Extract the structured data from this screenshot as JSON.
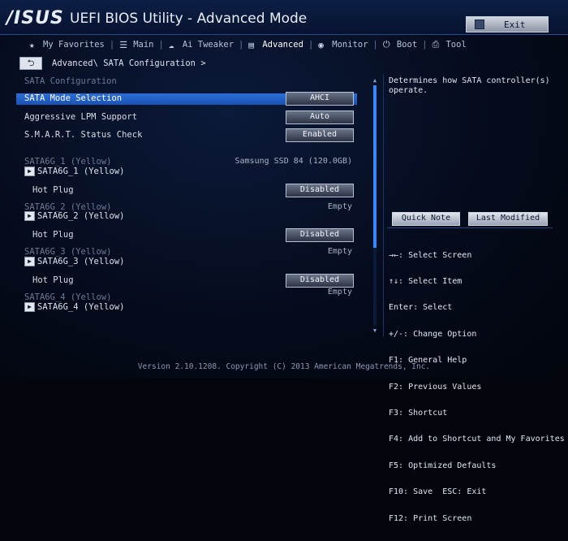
{
  "title_bar": {
    "logo": "/ISUS",
    "app_title": "UEFI BIOS Utility - Advanced Mode",
    "exit_label": "Exit"
  },
  "tabs": [
    {
      "label": "My Favorites",
      "icon": "star-icon"
    },
    {
      "label": "Main",
      "icon": "list-icon"
    },
    {
      "label": "Ai Tweaker",
      "icon": "tweaker-icon"
    },
    {
      "label": "Advanced",
      "icon": "advanced-icon",
      "active": true
    },
    {
      "label": "Monitor",
      "icon": "monitor-icon"
    },
    {
      "label": "Boot",
      "icon": "power-icon"
    },
    {
      "label": "Tool",
      "icon": "printer-icon"
    }
  ],
  "breadcrumb": {
    "back_symbol": "⮌",
    "path": "Advanced\\ SATA Configuration >"
  },
  "left": {
    "section_title": "SATA Configuration",
    "settings": [
      {
        "label": "SATA Mode Selection",
        "value": "AHCI",
        "highlighted": true
      },
      {
        "label": "Aggressive LPM Support",
        "value": "Auto"
      },
      {
        "label": "S.M.A.R.T. Status Check",
        "value": "Enabled"
      }
    ],
    "ports": [
      {
        "heading": "SATA6G_1 (Yellow)",
        "device": "Samsung SSD 84 (120.0GB)",
        "submenu": "SATA6G_1 (Yellow)",
        "hotplug_label": "Hot Plug",
        "hotplug_value": "Disabled"
      },
      {
        "heading": "SATA6G_2 (Yellow)",
        "device": "Empty",
        "submenu": "SATA6G_2 (Yellow)",
        "hotplug_label": "Hot Plug",
        "hotplug_value": "Disabled"
      },
      {
        "heading": "SATA6G_3 (Yellow)",
        "device": "Empty",
        "submenu": "SATA6G_3 (Yellow)",
        "hotplug_label": "Hot Plug",
        "hotplug_value": "Disabled"
      },
      {
        "heading": "SATA6G_4 (Yellow)",
        "device": "Empty",
        "submenu": "SATA6G_4 (Yellow)"
      }
    ]
  },
  "right": {
    "help_text": "Determines how SATA controller(s) operate.",
    "quick_note_label": "Quick Note",
    "last_modified_label": "Last Modified",
    "key_help": [
      "→←: Select Screen",
      "↑↓: Select Item",
      "Enter: Select",
      "+/-: Change Option",
      "F1: General Help",
      "F2: Previous Values",
      "F3: Shortcut",
      "F4: Add to Shortcut and My Favorites",
      "F5: Optimized Defaults",
      "F10: Save  ESC: Exit",
      "F12: Print Screen"
    ]
  },
  "footer": "Version 2.10.1208. Copyright (C) 2013 American Megatrends, Inc.",
  "colors": {
    "highlight": "#2a6fd8",
    "background": "#050b1c",
    "scrollbar": "#3a86ff"
  }
}
